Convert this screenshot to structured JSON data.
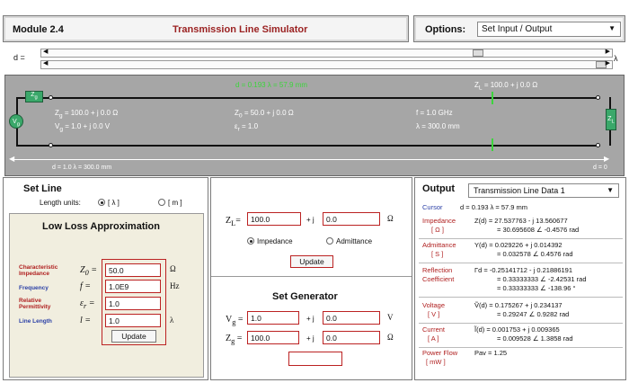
{
  "header": {
    "module": "Module 2.4",
    "title": "Transmission Line Simulator",
    "options_label": "Options:",
    "options_value": "Set Input / Output"
  },
  "slider": {
    "label": "d =",
    "unit": "λ",
    "top_position": 0.77,
    "bottom_position": 0.99
  },
  "diagram": {
    "top_green": "d = 0.193 λ = 57.9 mm",
    "zl_top": "Z",
    "zl_top_sub": "L",
    "zl_top_value": "= 100.0 + j 0.0  Ω",
    "zg_box": "Z",
    "zg_box_sub": "g",
    "vg_label": "V",
    "vg_sub": "g",
    "zl_box": "Z",
    "zl_box_sub": "L",
    "zg_text": "Z",
    "zg_text_sub": "g",
    "zg_value": "= 100.0 + j 0.0  Ω",
    "vg_text": "V",
    "vg_text_sub": "g",
    "vg_value": "= 1.0 + j 0.0 V",
    "z0_text": "Z",
    "z0_sub": "0",
    "z0_value": "= 50.0 + j 0.0  Ω",
    "er_text": "ε",
    "er_sub": "r",
    "er_value": "= 1.0",
    "f_value": "f  =  1.0  GHz",
    "lambda_value": "λ  =  300.0  mm",
    "bottom_left": "d = 1.0  λ  =  300.0 mm",
    "bottom_right": "d = 0"
  },
  "setline": {
    "title": "Set Line",
    "units_label": "Length units:",
    "unit_lambda": "[ λ ]",
    "unit_m": "[ m ]",
    "lowloss_title": "Low Loss Approximation",
    "params": [
      {
        "label1": "Characteristic",
        "label2": "Impedance",
        "symbol": "Z",
        "sub": "0",
        "value": "50.0",
        "unit": "Ω"
      },
      {
        "label1": "Frequency",
        "label2": "",
        "symbol": "f",
        "sub": "",
        "value": "1.0E9",
        "unit": "Hz"
      },
      {
        "label1": "Relative",
        "label2": "Permittivity",
        "symbol": "ε",
        "sub": "r",
        "value": "1.0",
        "unit": ""
      },
      {
        "label1": "Line Length",
        "label2": "",
        "symbol": "l",
        "sub": "",
        "value": "1.0",
        "unit": "λ"
      }
    ],
    "update": "Update"
  },
  "load": {
    "zl_label": "Z",
    "zl_sub": "L",
    "real": "100.0",
    "imag": "0.0",
    "plus_j": "+ j",
    "unit": "Ω",
    "impedance": "Impedance",
    "admittance": "Admittance",
    "update": "Update"
  },
  "generator": {
    "title": "Set Generator",
    "vg_label": "V",
    "vg_sub": "g",
    "vg_real": "1.0",
    "vg_imag": "0.0",
    "vg_unit": "V",
    "zg_label": "Z",
    "zg_sub": "g",
    "zg_real": "100.0",
    "zg_imag": "0.0",
    "zg_unit": "Ω",
    "plus_j": "+ j"
  },
  "output": {
    "title": "Output",
    "select": "Transmission Line Data 1",
    "cursor_label": "Cursor",
    "cursor_value": "d  = 0.193  λ  =  57.9 mm",
    "impedance_label": "Impedance",
    "impedance_unit": "[ Ω ]",
    "impedance_1": "Z(d)  = 27.537763 - j 13.560677",
    "impedance_2": "= 30.695608  ∠ -0.4576 rad",
    "admittance_label": "Admittance",
    "admittance_unit": "[ S ]",
    "admittance_1": "Y(d)  = 0.029226 + j 0.014392",
    "admittance_2": "= 0.032578  ∠ 0.4576 rad",
    "reflection_label1": "Reflection",
    "reflection_label2": "Coefficient",
    "reflection_1": "Γd  = -0.25141712 - j 0.21886191",
    "reflection_2": "= 0.33333333  ∠ -2.42531 rad",
    "reflection_3": "= 0.33333333  ∠ -138.96 °",
    "voltage_label": "Voltage",
    "voltage_unit": "[ V ]",
    "voltage_1": "Ṽ(d)  = 0.175267 + j 0.234137",
    "voltage_2": "= 0.29247  ∠ 0.9282 rad",
    "current_label": "Current",
    "current_unit": "[ A ]",
    "current_1": "Ĩ(d)  = 0.001753 + j 0.009365",
    "current_2": "= 0.009528  ∠ 1.3858 rad",
    "power_label1": "Power Flow",
    "power_label2": "[ mW ]",
    "power_value": "Pav  = 1.25"
  },
  "colors": {
    "title_red": "#9b2222",
    "label_red": "#b02020",
    "label_blue": "#2a3fa6",
    "diagram_gray": "#a6a6a6",
    "component_green": "#3aa86a"
  }
}
